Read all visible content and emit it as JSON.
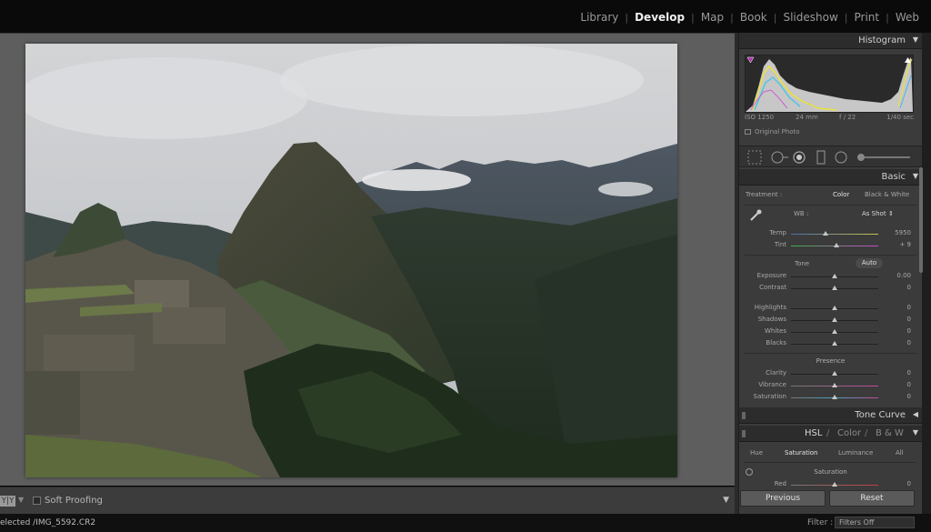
{
  "modules": [
    "Library",
    "Develop",
    "Map",
    "Book",
    "Slideshow",
    "Print",
    "Web"
  ],
  "active_module": "Develop",
  "toolbar": {
    "view_mode": "Y|Y",
    "soft_proofing": "Soft Proofing"
  },
  "filmstrip": {
    "selected": "elected /IMG_5592.CR2",
    "filter_label": "Filter :",
    "filter_value": "Filters Off"
  },
  "histogram": {
    "title": "Histogram",
    "iso": "ISO 1250",
    "focal": "24 mm",
    "aperture": "f / 22",
    "shutter": "1/40 sec",
    "original_photo": "Original Photo"
  },
  "basic": {
    "title": "Basic",
    "treatment_label": "Treatment :",
    "treatment_color": "Color",
    "treatment_bw": "Black & White",
    "wb_label": "WB :",
    "wb_value": "As Shot",
    "temp_label": "Temp",
    "temp_value": "5950",
    "tint_label": "Tint",
    "tint_value": "+ 9",
    "tone_label": "Tone",
    "auto_label": "Auto",
    "exposure_label": "Exposure",
    "exposure_value": "0.00",
    "contrast_label": "Contrast",
    "contrast_value": "0",
    "highlights_label": "Highlights",
    "highlights_value": "0",
    "shadows_label": "Shadows",
    "shadows_value": "0",
    "whites_label": "Whites",
    "whites_value": "0",
    "blacks_label": "Blacks",
    "blacks_value": "0",
    "presence_label": "Presence",
    "clarity_label": "Clarity",
    "clarity_value": "0",
    "vibrance_label": "Vibrance",
    "vibrance_value": "0",
    "saturation_label": "Saturation",
    "saturation_value": "0"
  },
  "tone_curve": {
    "title": "Tone Curve"
  },
  "hsl": {
    "hsl_label": "HSL",
    "color_label": "Color",
    "bw_label": "B & W",
    "slash": "/",
    "tabs": [
      "Hue",
      "Saturation",
      "Luminance",
      "All"
    ],
    "active_tab": "Saturation",
    "section_label": "Saturation",
    "red_label": "Red",
    "red_value": "0"
  },
  "buttons": {
    "previous": "Previous",
    "reset": "Reset"
  },
  "colors": {
    "accent": "#ffffff",
    "panel": "#3b3b3b",
    "header": "#2c2c2c"
  }
}
